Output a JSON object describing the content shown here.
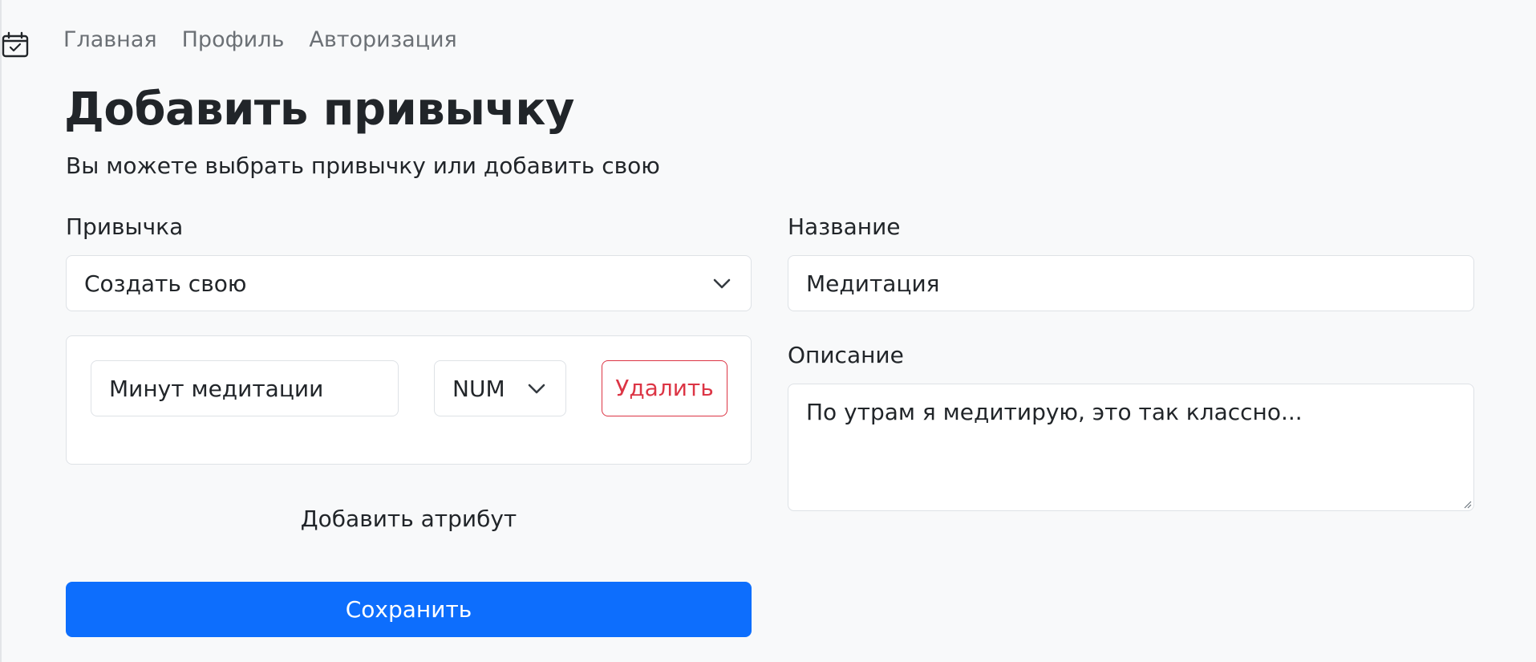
{
  "nav": {
    "brand_icon": "calendar-check-icon",
    "links": [
      {
        "label": "Главная"
      },
      {
        "label": "Профиль"
      },
      {
        "label": "Авторизация"
      }
    ]
  },
  "page": {
    "title": "Добавить привычку",
    "lead": "Вы можете выбрать привычку или добавить свою"
  },
  "habit": {
    "label": "Привычка",
    "selected": "Создать свою"
  },
  "attributes": [
    {
      "name": "Минут медитации",
      "type": "NUM",
      "delete_label": "Удалить"
    }
  ],
  "add_attribute_label": "Добавить атрибут",
  "save_label": "Сохранить",
  "name_field": {
    "label": "Название",
    "value": "Медитация"
  },
  "description_field": {
    "label": "Описание",
    "value": "По утрам я медитирую, это так классно..."
  },
  "colors": {
    "primary": "#0d6efd",
    "danger": "#dc3545",
    "background": "#f8f9fa",
    "border": "#dee2e6",
    "text": "#212529",
    "nav_text": "#6b7075"
  }
}
